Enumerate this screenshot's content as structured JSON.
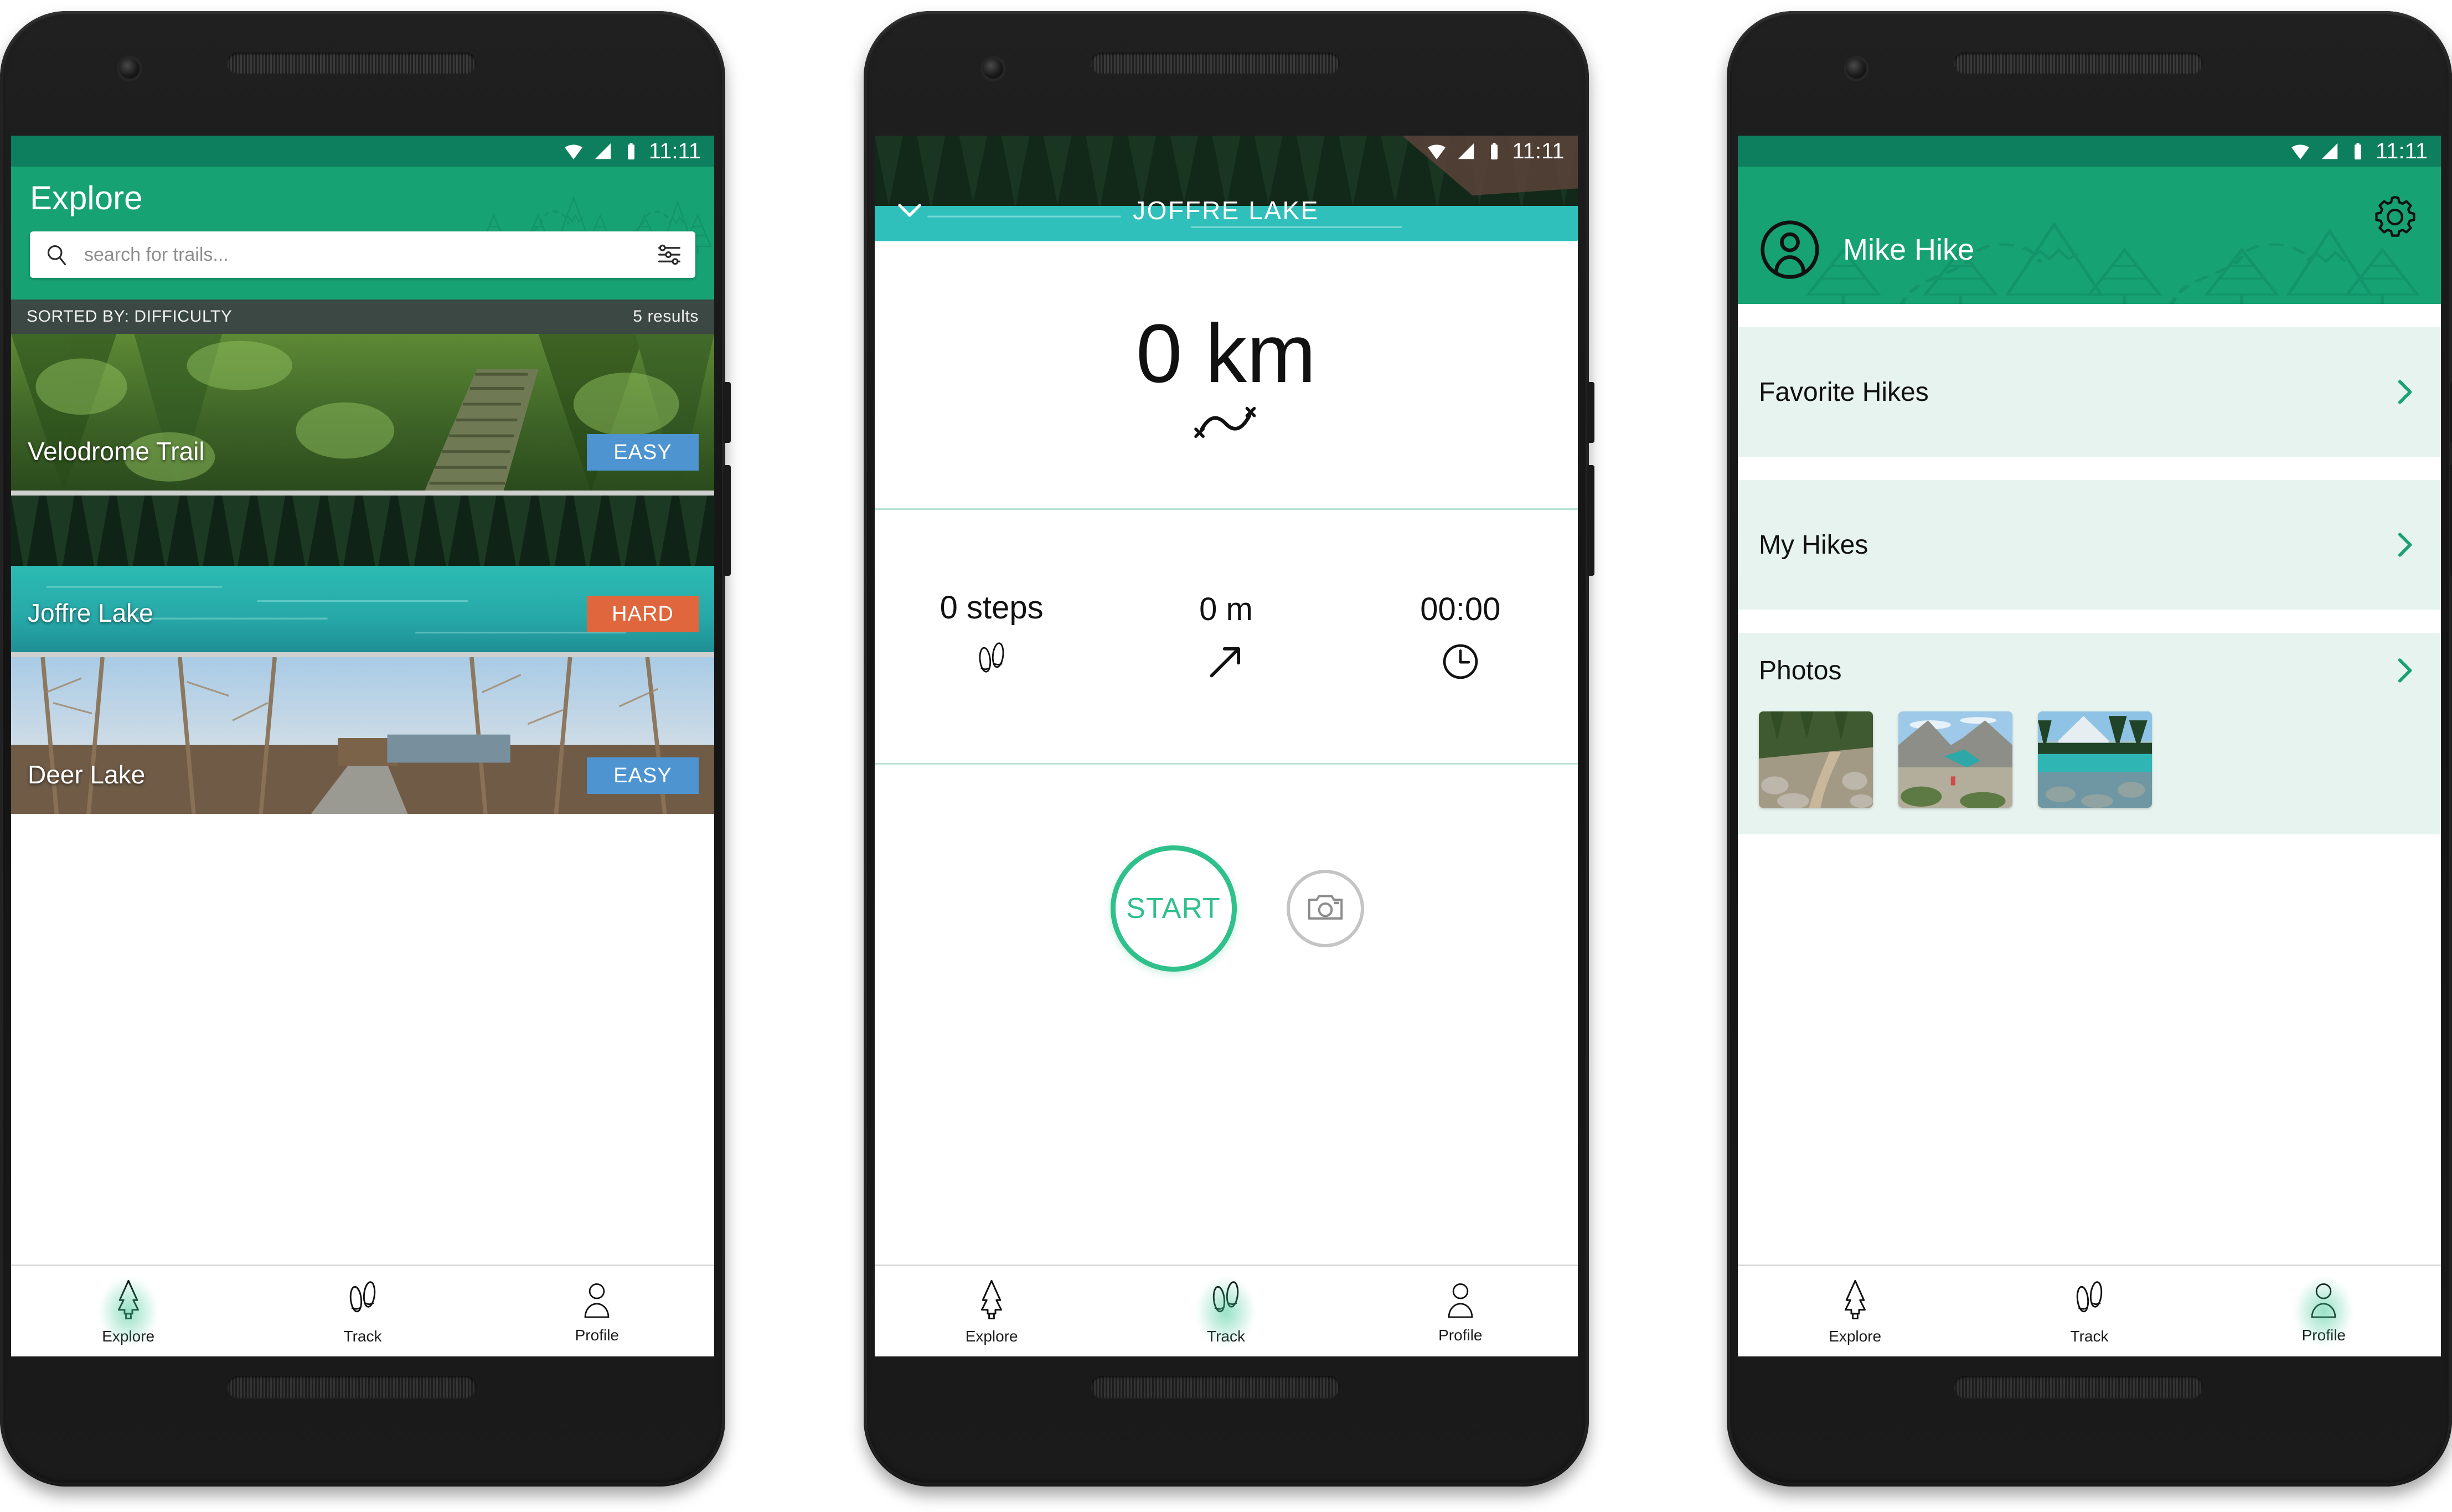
{
  "app": {
    "accent_green": "#17A273",
    "status_green": "#0D7F5E",
    "mint_row": "#E7F3EF",
    "easy_color": "#4D94D1",
    "hard_color": "#E0673D",
    "start_color": "#2FC08C"
  },
  "status_bar": {
    "time": "11:11",
    "icons": [
      "wifi-icon",
      "cell-signal-icon",
      "battery-icon"
    ]
  },
  "explore_screen": {
    "title": "Explore",
    "search": {
      "placeholder": "search for trails...",
      "value": ""
    },
    "search_icon": "search-icon",
    "filter_icon": "filter-sliders-icon",
    "sorted_label": "SORTED BY: DIFFICULTY",
    "results_label": "5 results",
    "trails": [
      {
        "name": "Velodrome Trail",
        "difficulty": "EASY",
        "difficulty_class": "easy"
      },
      {
        "name": "Joffre Lake",
        "difficulty": "HARD",
        "difficulty_class": "hard"
      },
      {
        "name": "Deer Lake",
        "difficulty": "EASY",
        "difficulty_class": "easy"
      }
    ]
  },
  "track_screen": {
    "title": "JOFFRE LAKE",
    "back_icon": "chevron-down-icon",
    "distance": "0 km",
    "route_icon": "route-squiggle-icon",
    "stats": [
      {
        "value": "0 steps",
        "icon": "footsteps-icon"
      },
      {
        "value": "0 m",
        "icon": "elevation-arrow-icon"
      },
      {
        "value": "00:00",
        "icon": "clock-icon"
      }
    ],
    "start_label": "START",
    "camera_icon": "camera-icon"
  },
  "profile_screen": {
    "user_name": "Mike Hike",
    "avatar_icon": "user-avatar-icon",
    "settings_icon": "gear-icon",
    "menu": [
      {
        "label": "Favorite Hikes",
        "chevron": "chevron-right-icon"
      },
      {
        "label": "My Hikes",
        "chevron": "chevron-right-icon"
      }
    ],
    "photos": {
      "label": "Photos",
      "chevron": "chevron-right-icon",
      "items": [
        "rocky-trail-photo",
        "alpine-valley-photo",
        "glacier-lake-photo"
      ]
    }
  },
  "bottom_nav": {
    "items": [
      {
        "label": "Explore",
        "icon": "pine-tree-icon"
      },
      {
        "label": "Track",
        "icon": "footsteps-icon"
      },
      {
        "label": "Profile",
        "icon": "person-icon"
      }
    ],
    "active": {
      "phone1": 0,
      "phone2": 1,
      "phone3": 2
    }
  }
}
